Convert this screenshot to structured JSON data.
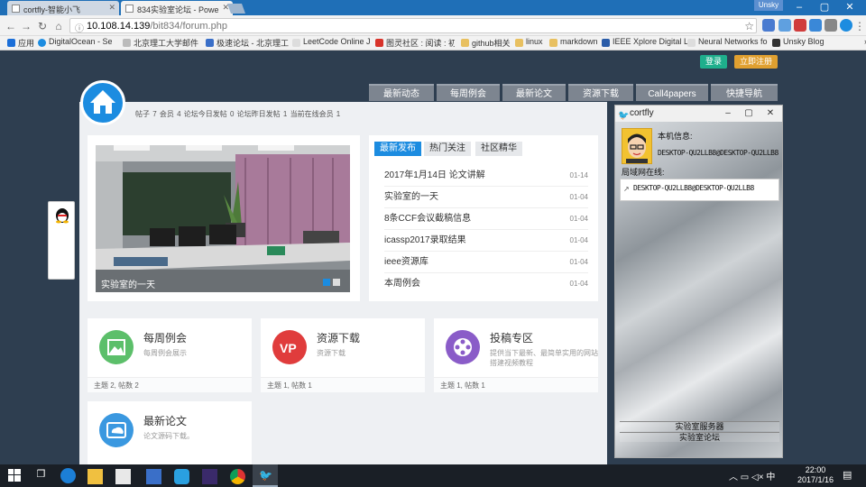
{
  "browser": {
    "tabs": [
      {
        "title": "cortfly-智能小飞"
      },
      {
        "title": "834实验室论坛 - Powe"
      }
    ],
    "user_badge": "Unsky",
    "url_host": "10.108.14.139",
    "url_path": "/bit834/forum.php",
    "bookmarks": [
      "应用",
      "DigitalOcean - Setti",
      "北京理工大学邮件系",
      "极速论坛 - 北京理工",
      "LeetCode Online Ju",
      "图灵社区 : 阅读 : 初",
      "github相关",
      "linux",
      "markdown",
      "IEEE Xplore Digital L",
      "Neural Networks fo",
      "Unsky Blog"
    ]
  },
  "header": {
    "login_label": "登录",
    "register_label": "立即注册",
    "stats": "帖子 7   会员 4   论坛今日发帖 0   论坛昨日发帖 1   当前在线会员 1",
    "nav_tabs": [
      "最新动态",
      "每周例会",
      "最新论文",
      "资源下载",
      "Call4papers",
      "快捷导航"
    ]
  },
  "slider": {
    "caption": "实验室的一天"
  },
  "news": {
    "tabs": [
      "最新发布",
      "热门关注",
      "社区精华"
    ],
    "items": [
      {
        "title": "2017年1月14日 论文讲解",
        "date": "01-14"
      },
      {
        "title": "实验室的一天",
        "date": "01-04"
      },
      {
        "title": "8条CCF会议截稿信息",
        "date": "01-04"
      },
      {
        "title": "icassp2017录取结果",
        "date": "01-04"
      },
      {
        "title": "ieee资源库",
        "date": "01-04"
      },
      {
        "title": "本周例会",
        "date": "01-04"
      }
    ]
  },
  "forums": [
    {
      "title": "每周例会",
      "desc": "每周例会展示",
      "foot": "主题 2, 帖数 2",
      "color": "#5cbf6a"
    },
    {
      "title": "资源下载",
      "desc": "资源下载",
      "foot": "主题 1, 帖数 1",
      "color": "#e03c3c"
    },
    {
      "title": "投稿专区",
      "desc": "提供当下最新、最简单实用的网站",
      "desc2": "搭建视频教程",
      "foot": "主题 1, 帖数 1",
      "color": "#8a5cc8"
    },
    {
      "title": "最新论文",
      "desc": "论文源码下载。",
      "foot": "",
      "color": "#3a98e0"
    }
  ],
  "app_window": {
    "title": "cortfly",
    "info_label": "本机信息:",
    "host": "DESKTOP-QU2LLB8@DESKTOP-QU2LLB8",
    "lan_label": "局域网在线:",
    "entries": [
      "DESKTOP-QU2LLB8@DESKTOP-QU2LLB8"
    ],
    "button1": "实验室服务器",
    "button2": "实验室论坛"
  },
  "taskbar": {
    "time": "22:00",
    "date": "2017/1/16"
  }
}
